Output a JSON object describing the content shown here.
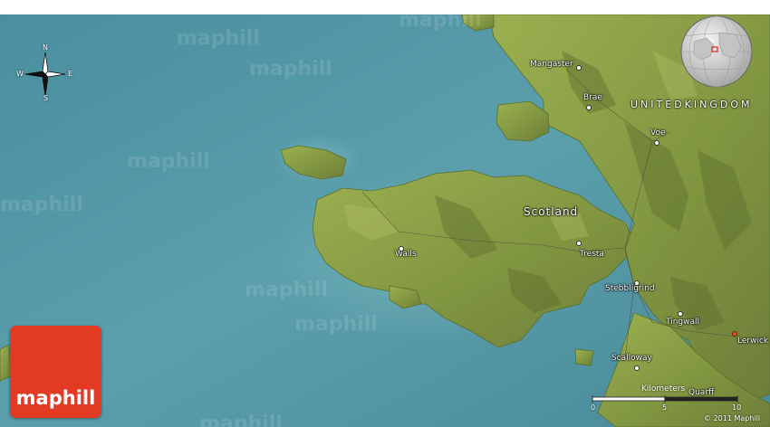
{
  "map": {
    "region_label": "Scotland",
    "country_label": "UNITEDKINGDOM",
    "places": [
      {
        "name": "Mangaster"
      },
      {
        "name": "Brae"
      },
      {
        "name": "Voe"
      },
      {
        "name": "Walls"
      },
      {
        "name": "Tresta"
      },
      {
        "name": "Stebbligrind"
      },
      {
        "name": "Tingwall"
      },
      {
        "name": "Lerwick",
        "capital": true
      },
      {
        "name": "Scalloway"
      },
      {
        "name": "Quarff"
      }
    ],
    "watermark_text": "maphill"
  },
  "compass": {
    "n": "N",
    "s": "S",
    "e": "E",
    "w": "W"
  },
  "logo": {
    "text": "maphill"
  },
  "scale": {
    "unit_label": "Kilometers",
    "ticks": [
      "0",
      "5",
      "10"
    ]
  },
  "copyright": "© 2011 Maphill",
  "colors": {
    "sea": "#4c93a3",
    "land": "#8aa24a",
    "logo": "#e33a24"
  }
}
